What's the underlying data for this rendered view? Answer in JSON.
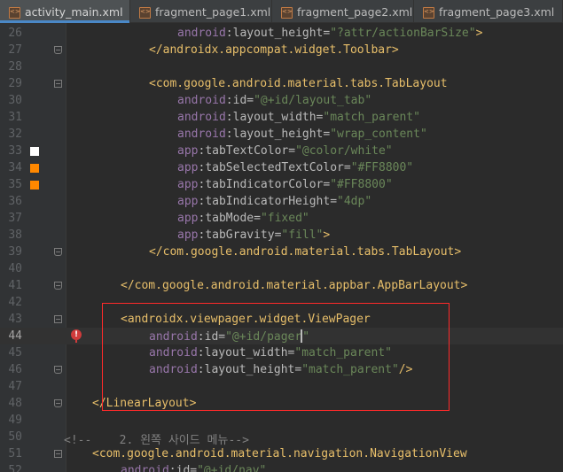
{
  "tabs": [
    {
      "label": "activity_main.xml",
      "active": true
    },
    {
      "label": "fragment_page1.xml",
      "active": false
    },
    {
      "label": "fragment_page2.xml",
      "active": false
    },
    {
      "label": "fragment_page3.xml",
      "active": false
    }
  ],
  "tab_close_glyph": "×",
  "lines": {
    "l26": {
      "num": "26",
      "tag_open": "",
      "tag": "",
      "ns": "android",
      "colon": ":",
      "attr": "layout_height",
      "eq": "=",
      "val": "\"?attr/actionBarSize\"",
      "tail": ">"
    },
    "l27": {
      "num": "27",
      "text": "</androidx.appcompat.widget.Toolbar>"
    },
    "l28": {
      "num": "28"
    },
    "l29": {
      "num": "29",
      "text": "<com.google.android.material.tabs.TabLayout"
    },
    "l30": {
      "num": "30",
      "ns": "android",
      "attr": "id",
      "val": "\"@+id/layout_tab\""
    },
    "l31": {
      "num": "31",
      "ns": "android",
      "attr": "layout_width",
      "val": "\"match_parent\""
    },
    "l32": {
      "num": "32",
      "ns": "android",
      "attr": "layout_height",
      "val": "\"wrap_content\""
    },
    "l33": {
      "num": "33",
      "ns": "app",
      "attr": "tabTextColor",
      "val": "\"@color/white\""
    },
    "l34": {
      "num": "34",
      "ns": "app",
      "attr": "tabSelectedTextColor",
      "val": "\"#FF8800\""
    },
    "l35": {
      "num": "35",
      "ns": "app",
      "attr": "tabIndicatorColor",
      "val": "\"#FF8800\""
    },
    "l36": {
      "num": "36",
      "ns": "app",
      "attr": "tabIndicatorHeight",
      "val": "\"4dp\""
    },
    "l37": {
      "num": "37",
      "ns": "app",
      "attr": "tabMode",
      "val": "\"fixed\""
    },
    "l38": {
      "num": "38",
      "ns": "app",
      "attr": "tabGravity",
      "val": "\"fill\"",
      "tail": ">"
    },
    "l39": {
      "num": "39",
      "text": "</com.google.android.material.tabs.TabLayout>"
    },
    "l40": {
      "num": "40"
    },
    "l41": {
      "num": "41",
      "text": "</com.google.android.material.appbar.AppBarLayout>"
    },
    "l42": {
      "num": "42"
    },
    "l43": {
      "num": "43",
      "text": "<androidx.viewpager.widget.ViewPager"
    },
    "l44": {
      "num": "44",
      "ns": "android",
      "attr": "id",
      "val_a": "\"@+id/pager",
      "val_b": "\""
    },
    "l45": {
      "num": "45",
      "ns": "android",
      "attr": "layout_width",
      "val": "\"match_parent\""
    },
    "l46": {
      "num": "46",
      "ns": "android",
      "attr": "layout_height",
      "val": "\"match_parent\"",
      "tail": "/>"
    },
    "l47": {
      "num": "47"
    },
    "l48": {
      "num": "48",
      "text": "</LinearLayout>"
    },
    "l49": {
      "num": "49"
    },
    "l50": {
      "num": "50",
      "text": "<!--    2. 왼쪽 사이드 메뉴-->"
    },
    "l51": {
      "num": "51",
      "text": "<com.google.android.material.navigation.NavigationView"
    },
    "l52": {
      "num": "52",
      "ns": "android",
      "attr": "id",
      "val": "\"@+id/nav\""
    }
  },
  "gutter_colors": {
    "l33": "#ffffff",
    "l34": "#ff8800",
    "l35": "#ff8800"
  },
  "error_glyph": "!",
  "highlight_color": "#ff2a2a"
}
